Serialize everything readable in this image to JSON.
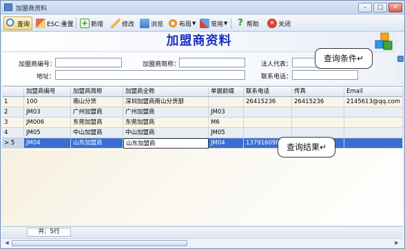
{
  "window": {
    "title": "加盟商资料"
  },
  "toolbar": {
    "query": "查询",
    "reset": "ESC:重置",
    "add": "新增",
    "edit": "修改",
    "browse": "浏览",
    "layout": "布局",
    "common": "常用",
    "help": "帮助",
    "close": "关闭"
  },
  "page": {
    "title": "加盟商资料"
  },
  "filter": {
    "code_label": "加盟商编号：",
    "short_label": "加盟商简称：",
    "legal_label": "法人代表：",
    "address_label": "地址：",
    "phone_label": "联系电话：",
    "code_value": "",
    "short_value": "",
    "legal_value": "",
    "address_value": "",
    "phone_value": ""
  },
  "annotations": {
    "query_conditions": "查询条件↵",
    "query_results": "查询结果↵"
  },
  "table": {
    "columns": [
      "加盟商编号",
      "加盟商简称",
      "加盟商全称",
      "单据前缀",
      "联系电话",
      "传真",
      "Email"
    ],
    "rows": [
      {
        "num": "1",
        "code": "100",
        "short": "南山分货",
        "full": "深圳加盟商南山分货部",
        "prefix": "",
        "phone": "26415236",
        "fax": "26415236",
        "email": "2145613@qq.com"
      },
      {
        "num": "2",
        "code": "JM03",
        "short": "广州加盟商",
        "full": "广州加盟商",
        "prefix": "JM03",
        "phone": "",
        "fax": "",
        "email": ""
      },
      {
        "num": "3",
        "code": "JM006",
        "short": "东莞加盟商",
        "full": "东莞加盟商",
        "prefix": "M6",
        "phone": "",
        "fax": "",
        "email": ""
      },
      {
        "num": "4",
        "code": "JM05",
        "short": "中山加盟商",
        "full": "中山加盟商",
        "prefix": "JM05",
        "phone": "",
        "fax": "",
        "email": ""
      },
      {
        "num": "> 5",
        "code": "JM04",
        "short": "山东加盟商",
        "full": "山东加盟商",
        "prefix": "JM04",
        "phone": "13791609888",
        "fax": "",
        "email": ""
      }
    ]
  },
  "status": {
    "count_text": "共：5行"
  },
  "colors": {
    "title": "#1a2fc2",
    "selected_row": "#3b6fcf"
  }
}
